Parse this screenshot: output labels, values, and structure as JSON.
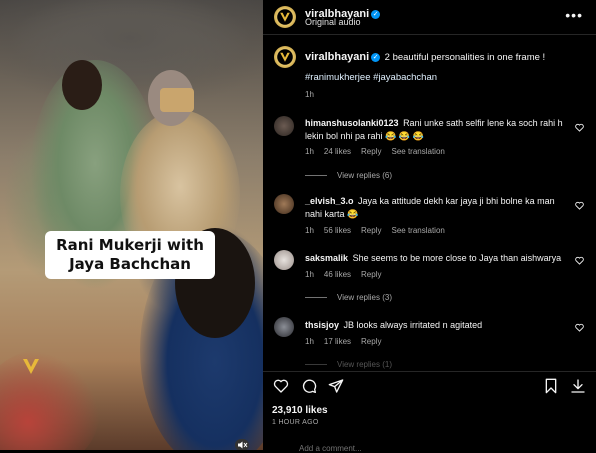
{
  "video": {
    "caption_line1": "Rani Mukerji with",
    "caption_line2": "Jaya Bachchan"
  },
  "post": {
    "username": "viralbhayani",
    "audio": "Original audio",
    "caption": "2 beautiful personalities in one frame !",
    "hashtags": "#ranimukherjee #jayabachchan",
    "age": "1h"
  },
  "comments": [
    {
      "user": "himanshusolanki0123",
      "text": "Rani unke sath selfir lene ka soch rahi h lekin bol nhi pa rahi 😂 😂 😂",
      "age": "1h",
      "likes": "24 likes",
      "reply": "Reply",
      "translation": "See translation",
      "replies": "View replies (6)"
    },
    {
      "user": "_elvish_3.o",
      "text": "Jaya ka attitude dekh kar jaya ji bhi bolne ka man nahi karta 😂",
      "age": "1h",
      "likes": "56 likes",
      "reply": "Reply",
      "translation": "See translation"
    },
    {
      "user": "saksmalik",
      "text": "She seems to be more close to Jaya than aishwarya",
      "age": "1h",
      "likes": "46 likes",
      "reply": "Reply",
      "replies": "View replies (3)"
    },
    {
      "user": "thsisjoy",
      "text": "JB looks always irritated n agitated",
      "age": "1h",
      "likes": "17 likes",
      "reply": "Reply",
      "replies": "View replies (1)"
    }
  ],
  "footer": {
    "likes": "23,910 likes",
    "time": "1 HOUR AGO",
    "add_comment": "Add a comment..."
  },
  "icons": {
    "more": "more-icon",
    "like": "heart-icon",
    "comment": "comment-icon",
    "share": "share-icon",
    "save": "bookmark-icon",
    "download": "download-icon"
  },
  "colors": {
    "accent": "#0095f6",
    "brand_gold": "#e7c66a",
    "secondary_text": "#a8a8a8"
  }
}
